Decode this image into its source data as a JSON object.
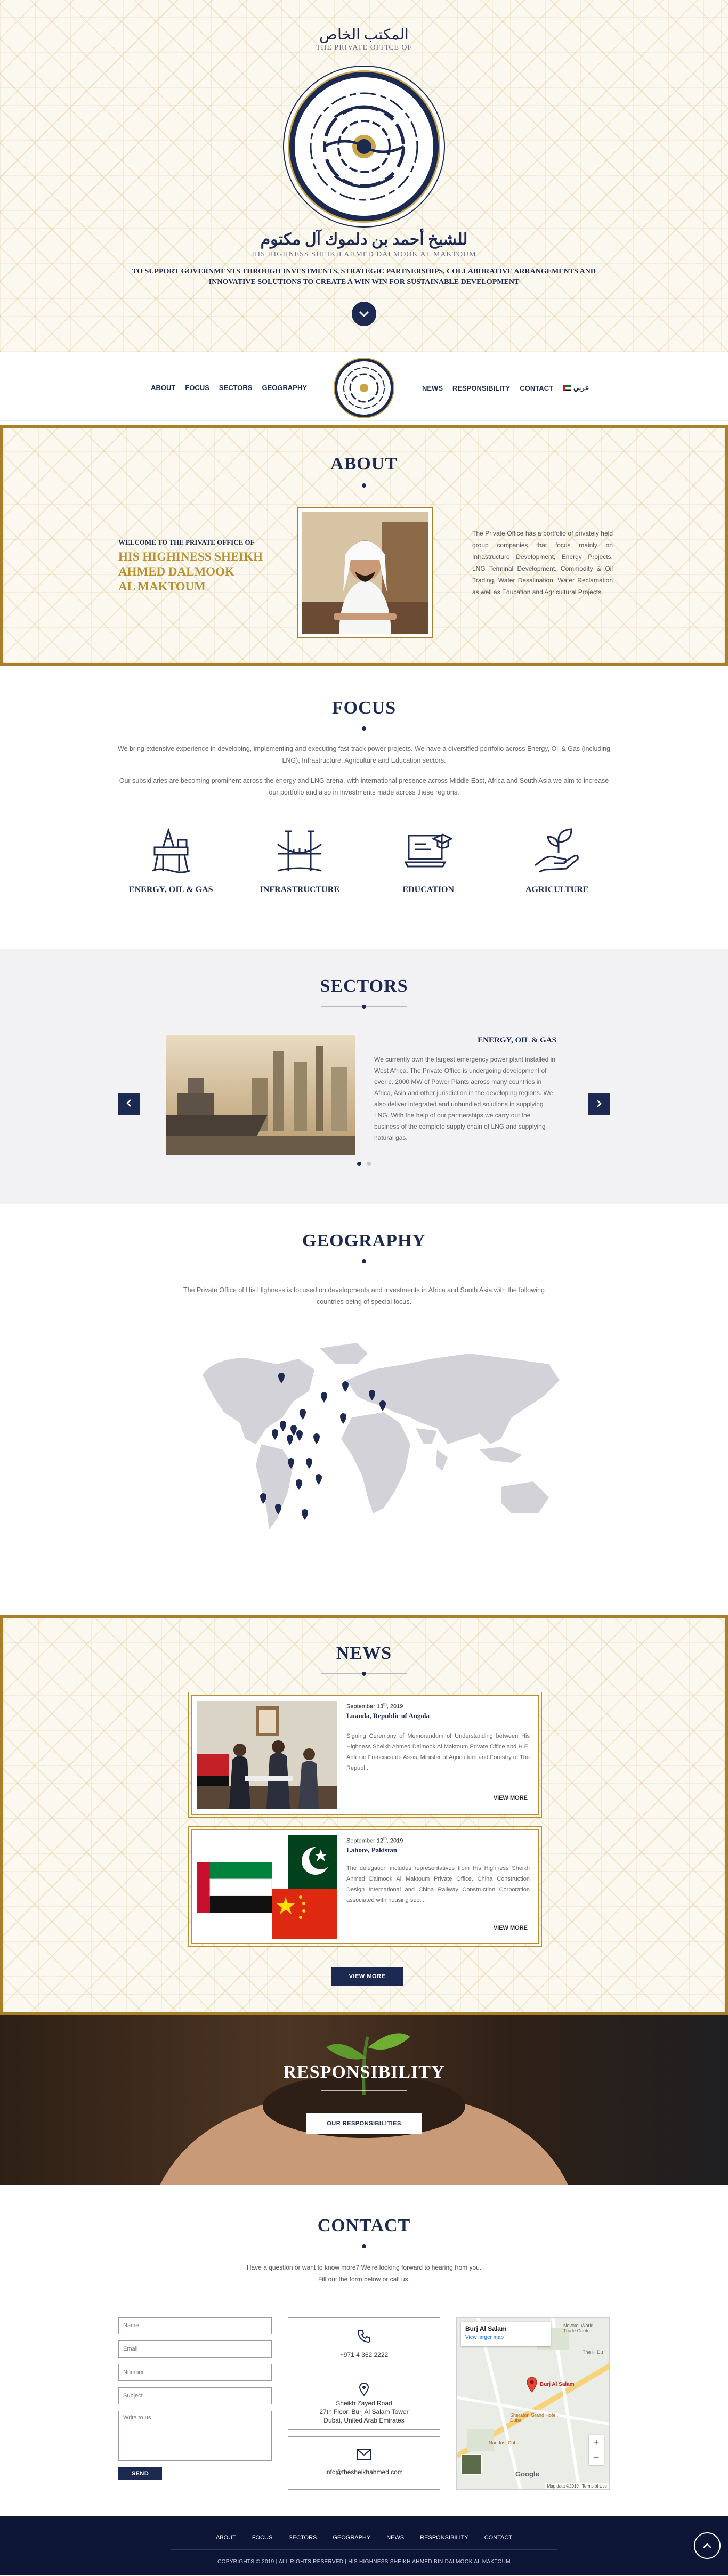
{
  "hero": {
    "arabic_office": "المكتب الخاص",
    "english_office": "THE PRIVATE OFFICE OF",
    "arabic_name": "للشيخ أحمد بن دلموك آل مكتوم",
    "english_name": "HIS HIGHNESS SHEIKH AHMED DALMOOK AL MAKTOUM",
    "tagline_1": "TO SUPPORT GOVERNMENTS THROUGH INVESTMENTS, STRATEGIC PARTNERSHIPS, COLLABORATIVE ARRANGEMENTS AND",
    "tagline_2": "INNOVATIVE SOLUTIONS TO CREATE A WIN WIN FOR SUSTAINABLE DEVELOPMENT",
    "scroll_icon": "chevron-down-icon"
  },
  "nav": {
    "left": [
      "ABOUT",
      "FOCUS",
      "SECTORS",
      "GEOGRAPHY"
    ],
    "right": [
      "NEWS",
      "RESPONSIBILITY",
      "CONTACT"
    ],
    "language": "عربي"
  },
  "about": {
    "title": "ABOUT",
    "welcome": "WELCOME TO THE PRIVATE OFFICE OF",
    "name_1": "HIS HIGHINESS SHEIKH",
    "name_2": "AHMED DALMOOK",
    "name_3": "AL MAKTOUM",
    "body": "The Private Office has a portfolio of privately held group companies that focus mainly on Infrastructure Development, Energy Projects, LNG Terminal Development, Commodity & Oil Trading, Water Desalination, Water Reclamation as well as Education and Agricultural Projects."
  },
  "focus": {
    "title": "FOCUS",
    "para_1": "We bring extensive experience in developing, implementing and executing fast-track power projects. We have a diversified portfolio across Energy, Oil & Gas (including LNG), Infrastructure, Agriculture and Education sectors.",
    "para_2": "Our subsidiaries are becoming prominent across the energy and LNG arena, with international presence across Middle East, Africa and South Asia we aim to increase our portfolio and also in investments made across these regions.",
    "items": [
      {
        "label": "ENERGY, OIL & GAS",
        "icon": "oil-rig-icon"
      },
      {
        "label": "INFRASTRUCTURE",
        "icon": "bridge-icon"
      },
      {
        "label": "EDUCATION",
        "icon": "education-icon"
      },
      {
        "label": "AGRICULTURE",
        "icon": "plant-hand-icon"
      }
    ]
  },
  "sectors": {
    "title": "SECTORS",
    "slide_title": "ENERGY, OIL & GAS",
    "slide_body": "We currently own the largest emergency power plant installed in West Africa. The Private Office is undergoing development of over c. 2000 MW of Power Plants across many countries in Africa, Asia and other jurisdiction in the developing regions. We also deliver integrated and unbundled solutions in supplying LNG. With the help of our partnerships we carry out the business of the complete supply chain of LNG and supplying natural gas."
  },
  "geography": {
    "title": "GEOGRAPHY",
    "para": "The Private Office of His Highness is focused on developments and investments in Africa and South Asia with the following countries being of special focus."
  },
  "news": {
    "title": "NEWS",
    "items": [
      {
        "day": "September 13",
        "sup": "th",
        "year": ", 2019",
        "place": "Luanda, Republic of Angola",
        "body": "Signing Ceremony of Memorandum of Understanding between His Highness Sheikh Ahmed Dalmook Al Maktoum Private Office and H.E. Antonio Francisco de Assis, Minister of Agriculture and Forestry of The Republ...",
        "more": "VIEW MORE"
      },
      {
        "day": "September 12",
        "sup": "th",
        "year": ", 2019",
        "place": "Lahore, Pakistan",
        "body": "The delegation includes representatives from His Highness Sheikh Ahmed Dalmook Al Maktoum Private Office, China Construction Design International and China Railway Construction Corporation associated with housing sect...",
        "more": "VIEW MORE"
      }
    ],
    "button": "VIEW MORE"
  },
  "responsibility": {
    "title": "RESPONSIBILITY",
    "button": "OUR RESPONSIBILITIES"
  },
  "contact": {
    "title": "CONTACT",
    "intro_1": "Have a question or want to know more? We're looking forward to hearing from you.",
    "intro_2": "Fill out the form below or call us.",
    "form": {
      "name": "Name",
      "email": "Email",
      "number": "Number",
      "subject": "Subject",
      "message": "Write to us",
      "send": "SEND"
    },
    "phone": "+971 4 362 2222",
    "address_1": "Sheikh Zayed Road",
    "address_2": "27th Floor, Burj Al Salam Tower",
    "address_3": "Dubai, United Arab Emirates",
    "email": "info@thesheikhahmed.com",
    "map": {
      "place": "Burj Al Salam",
      "link": "View larger map",
      "pin_label": "Burj Al Salam",
      "label_1": "Sheraton Grand Hotel, Dubai",
      "label_2": "Nandos, Dubai",
      "label_3": "The H Du",
      "label_4": "Novotel World Trade Centre",
      "footer": "Map data ©2019",
      "terms": "Terms of Use",
      "google": "Google"
    }
  },
  "footer": {
    "links": [
      "ABOUT",
      "FOCUS",
      "SECTORS",
      "GEOGRAPHY",
      "NEWS",
      "RESPONSIBILITY",
      "CONTACT"
    ],
    "copyright": "COPYRIGHTS © 2019 | ALL RIGHTS RESERVED | HIS HIGHNESS SHEIKH AHMED BIN DALMOOK AL MAKTOUM"
  },
  "colors": {
    "navy": "#1c2951",
    "gold": "#b8902f",
    "footer": "#0e1638"
  }
}
